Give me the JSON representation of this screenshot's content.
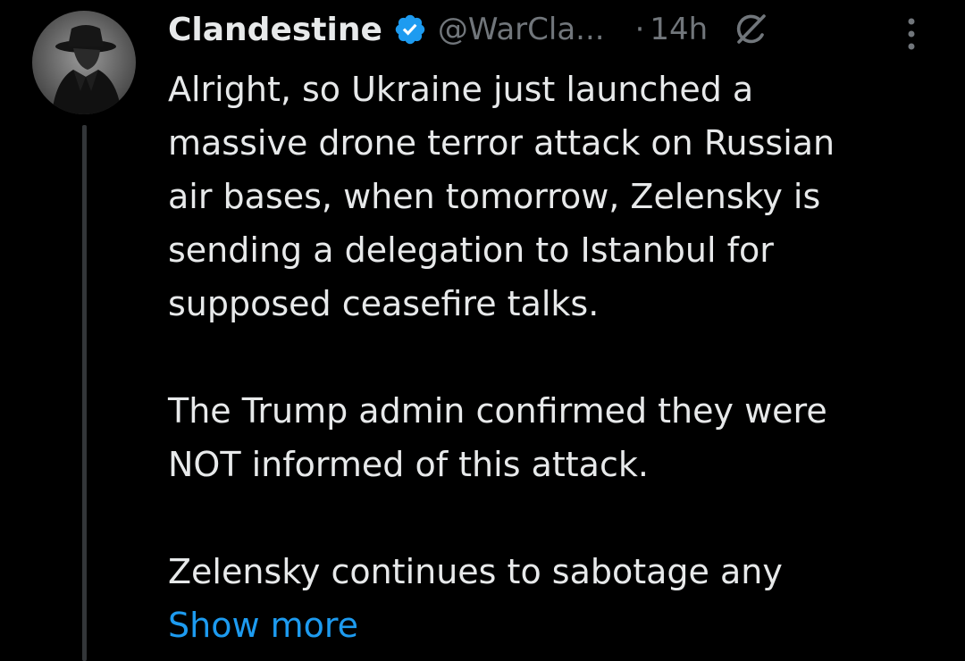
{
  "tweet": {
    "author": {
      "name": "Clandestine",
      "handle": "@WarCla...",
      "verified": true,
      "avatar_icon": "fedora-silhouette-avatar"
    },
    "separator": "·",
    "timestamp": "14h",
    "paragraphs": [
      "Alright, so Ukraine just launched a\nmassive drone terror attack on Russian\nair bases, when tomorrow, Zelensky is\nsending a delegation to Istanbul for\nsupposed ceasefire talks.",
      "The Trump admin confirmed they were\nNOT informed of this attack.",
      "Zelensky continues to sabotage any"
    ],
    "show_more_label": "Show more"
  },
  "icons": {
    "verified": "verified-badge-icon",
    "grok": "grok-icon",
    "more": "more-options-icon"
  },
  "colors": {
    "background": "#000000",
    "text": "#e7e9ea",
    "secondary": "#71767b",
    "link": "#1d9bf0",
    "thread_line": "#333639"
  }
}
